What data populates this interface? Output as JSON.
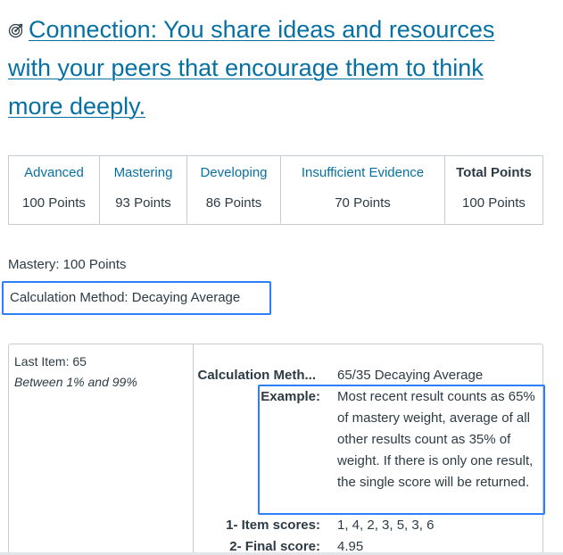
{
  "outcome": {
    "icon": "target-icon",
    "title": "Connection: You share ideas and resources with your peers that encourage them to think more deeply.",
    "link_color": "#0770a3"
  },
  "ratings": [
    {
      "description": "Advanced",
      "points": "100 Points"
    },
    {
      "description": "Mastering",
      "points": "93 Points"
    },
    {
      "description": "Developing",
      "points": "86 Points"
    },
    {
      "description": "Insufficient Evidence",
      "points": "70 Points"
    }
  ],
  "total": {
    "description": "Total Points",
    "points": "100 Points"
  },
  "mastery_text": "Mastery: 100 Points",
  "calculation_method_text": "Calculation Method: Decaying Average",
  "highlight_color": "#2d7ff9",
  "detail": {
    "last_item": "Last Item: 65",
    "range": "Between 1% and 99%",
    "rows": {
      "calc_method_label": "Calculation Meth...",
      "calc_method_value": "65/35 Decaying Average",
      "example_label": "Example:",
      "example_value": "Most recent result counts as 65% of mastery weight, average of all other results count as 35% of weight. If there is only one result, the single score will be returned.",
      "item_scores_label": "1- Item scores:",
      "item_scores_value": "1, 4, 2, 3, 5, 3, 6",
      "final_score_label": "2- Final score:",
      "final_score_value": "4.95"
    }
  }
}
